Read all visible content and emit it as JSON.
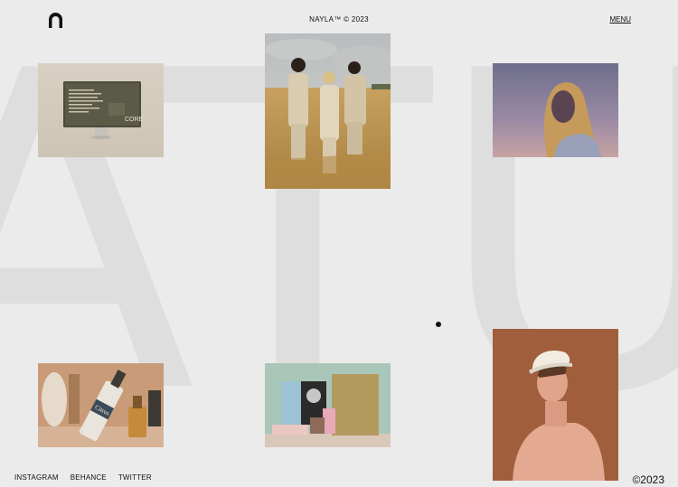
{
  "header": {
    "center_title": "NAYLA™ © 2023",
    "menu_label": "MENU"
  },
  "background_word": "ATURE",
  "gallery": {
    "tiles": [
      {
        "name": "monitor-core-mockup",
        "screen_text": "CORE"
      },
      {
        "name": "wheat-field-portrait"
      },
      {
        "name": "woman-sunset-portrait"
      },
      {
        "name": "bottles-still-life",
        "label_text": "Citrus"
      },
      {
        "name": "stationery-brand-set"
      },
      {
        "name": "man-sailor-hat-portrait"
      }
    ]
  },
  "footer": {
    "social_links": [
      "INSTAGRAM",
      "BEHANCE",
      "TWITTER"
    ],
    "copyright": "©2023"
  },
  "colors": {
    "background": "#ebebeb",
    "background_word": "#dedede",
    "text": "#111111"
  }
}
